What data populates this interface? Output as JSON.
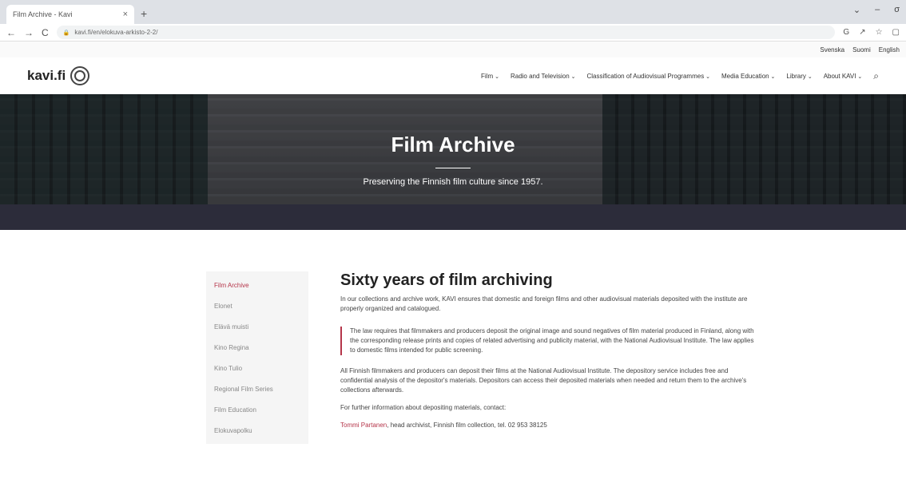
{
  "browser": {
    "tab_title": "Film Archive - Kavi",
    "tab_close": "×",
    "new_tab": "+",
    "url": "kavi.fi/en/elokuva-arkisto-2-2/",
    "back": "←",
    "forward": "→",
    "reload": "C",
    "lock": "🔒",
    "win_min": "⌄",
    "win_restore": "–",
    "win_close": "σ",
    "addr_icons": [
      "G",
      "↗",
      "☆",
      "▢"
    ]
  },
  "languages": [
    "Svenska",
    "Suomi",
    "English"
  ],
  "site": {
    "logo_text": "kavi.fi",
    "nav": [
      "Film",
      "Radio and Television",
      "Classification of Audiovisual Programmes",
      "Media Education",
      "Library",
      "About KAVI"
    ],
    "search_icon": "⌕"
  },
  "hero": {
    "title": "Film Archive",
    "subtitle": "Preserving the Finnish film culture since 1957."
  },
  "sidenav": [
    "Film Archive",
    "Elonet",
    "Elävä muisti",
    "Kino Regina",
    "Kino Tulio",
    "Regional Film Series",
    "Film Education",
    "Elokuvapolku"
  ],
  "article": {
    "title": "Sixty years of film archiving",
    "p1": "In our collections and archive work, KAVI ensures that domestic and foreign films and other audiovisual materials deposited with the institute are properly organized and catalogued.",
    "quote": "The law requires that filmmakers and producers deposit the original image and sound negatives of film material produced in Finland, along with the corresponding release prints and copies of related advertising and publicity material, with the National Audiovisual Institute. The law applies to domestic films intended for public screening.",
    "p2": "All Finnish filmmakers and producers can deposit their films at the National Audiovisual Institute. The depository service includes free and confidential analysis of the depositor's materials. Depositors can access their deposited materials when needed and return them to the archive's collections afterwards.",
    "p3": "For further information about depositing materials, contact:",
    "contact_name": "Tommi Partanen",
    "contact_rest": ", head archivist, Finnish film collection, tel. 02 953 38125"
  },
  "colors": {
    "accent": "#b5354a"
  }
}
